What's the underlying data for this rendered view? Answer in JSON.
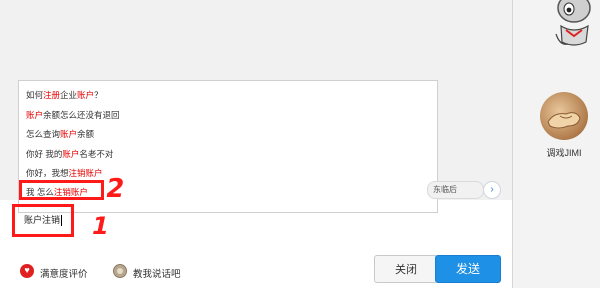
{
  "suggestions": [
    {
      "pre": "如何",
      "hl1": "注册",
      "mid": "企业",
      "hl2": "账户",
      "post": "？"
    },
    {
      "pre": "",
      "hl1": "账户",
      "mid": "余额怎么还没有退回",
      "hl2": "",
      "post": ""
    },
    {
      "pre": "怎么查询",
      "hl1": "账户",
      "mid": "余额",
      "hl2": "",
      "post": ""
    },
    {
      "pre": "你好 我的",
      "hl1": "账户",
      "mid": "名老不对",
      "hl2": "",
      "post": ""
    },
    {
      "pre": "你好，我想",
      "hl1": "注销",
      "mid": "",
      "hl2": "账户",
      "post": ""
    },
    {
      "pre": "我 怎么",
      "hl1": "注销",
      "mid": "",
      "hl2": "账户",
      "post": ""
    }
  ],
  "partial_tag": "东临后",
  "arrow": "›",
  "input": {
    "value": "账户注销"
  },
  "annotations": {
    "one": "1",
    "two": "2"
  },
  "bottom": {
    "satisfaction_label": "满意度评价",
    "teach_label": "教我说话吧",
    "close_label": "关闭",
    "send_label": "发送"
  },
  "agent": {
    "name": "调戏JIMI"
  },
  "colors": {
    "highlight": "#e60000",
    "send_button": "#1e90e6",
    "annotation": "#ff1a1a"
  }
}
